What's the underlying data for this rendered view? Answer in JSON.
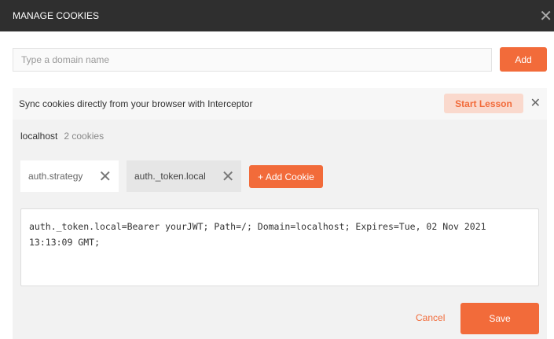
{
  "header": {
    "title": "MANAGE COOKIES",
    "close_icon": "close-icon"
  },
  "domain": {
    "placeholder": "Type a domain name",
    "value": "",
    "add_label": "Add"
  },
  "banner": {
    "text": "Sync cookies directly from your browser with Interceptor",
    "lesson_label": "Start Lesson"
  },
  "host": {
    "name": "localhost",
    "count": "2 cookies"
  },
  "cookies": [
    {
      "name": "auth.strategy"
    },
    {
      "name": "auth._token.local"
    }
  ],
  "add_cookie_label": "+ Add Cookie",
  "cookie_value": "auth._token.local=Bearer yourJWT; Path=/; Domain=localhost; Expires=Tue, 02 Nov 2021 13:13:09 GMT;",
  "actions": {
    "cancel": "Cancel",
    "save": "Save"
  },
  "colors": {
    "accent": "#f26b3a",
    "header": "#2f2f2f"
  }
}
